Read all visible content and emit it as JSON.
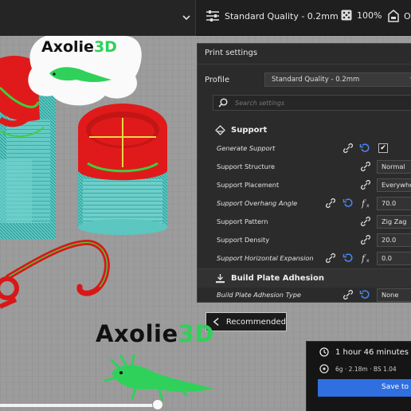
{
  "toolbar": {
    "quality": "Standard Quality - 0.2mm",
    "infill": "100%",
    "adhesion_partial": "O",
    "quality_icon": "sliders-icon",
    "infill_icon": "dice-icon",
    "adhesion_icon": "build-plate-icon"
  },
  "panel": {
    "title": "Print settings",
    "profile_label": "Profile",
    "profile_value": "Standard Quality - 0.2mm",
    "search_placeholder": "Search settings",
    "support": {
      "title": "Support",
      "rows": [
        {
          "label": "Generate Support",
          "value": "✔"
        },
        {
          "label": "Support Structure",
          "value": "Normal"
        },
        {
          "label": "Support Placement",
          "value": "Everywhere"
        },
        {
          "label": "Support Overhang Angle",
          "value": "70.0"
        },
        {
          "label": "Support Pattern",
          "value": "Zig Zag"
        },
        {
          "label": "Support Density",
          "value": "20.0"
        },
        {
          "label": "Support Horizontal Expansion",
          "value": "0.0"
        }
      ]
    },
    "adhesion": {
      "title": "Build Plate Adhesion",
      "rows": [
        {
          "label": "Build Plate Adhesion Type",
          "value": "None"
        }
      ]
    }
  },
  "recommended_label": "Recommended",
  "print_info": {
    "time": "1 hour 46 minutes",
    "material": "6g · 2.18m · BS 1.04",
    "save_label": "Save to D"
  },
  "brand": {
    "prefix": "Axolie",
    "suffix": "3D"
  },
  "colors": {
    "accent": "#2f6fe0",
    "support_red": "#e11d1d",
    "cyan": "#4fc4c0",
    "green": "#2fd15a"
  }
}
